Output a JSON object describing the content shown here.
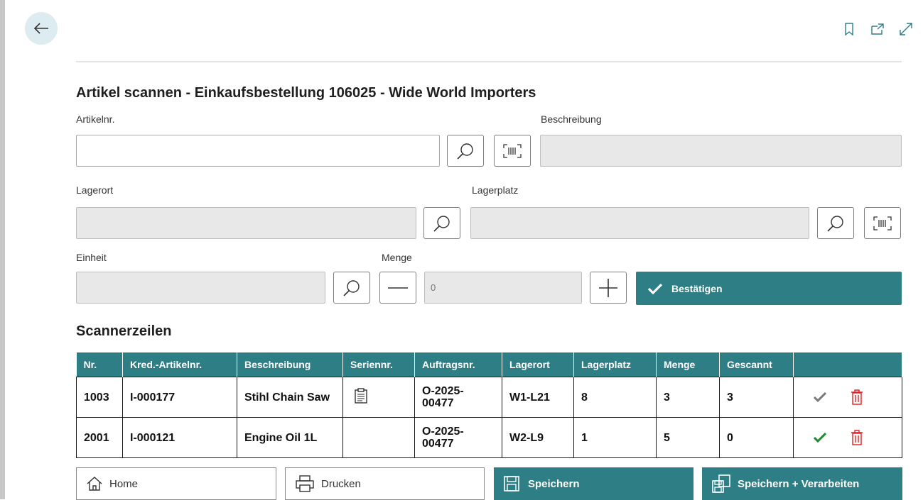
{
  "page": {
    "title": "Artikel scannen - Einkaufsbestellung 106025 - Wide World Importers"
  },
  "form": {
    "item_no_label": "Artikelnr.",
    "item_no_value": "",
    "description_label": "Beschreibung",
    "description_value": "",
    "location_label": "Lagerort",
    "location_value": "",
    "bin_label": "Lagerplatz",
    "bin_value": "",
    "unit_label": "Einheit",
    "unit_value": "",
    "quantity_label": "Menge",
    "quantity_placeholder": "0",
    "confirm_label": "Bestätigen"
  },
  "scanner_lines": {
    "title": "Scannerzeilen",
    "columns": [
      "Nr.",
      "Kred.-Artikelnr.",
      "Beschreibung",
      "Seriennr.",
      "Auftragsnr.",
      "Lagerort",
      "Lagerplatz",
      "Menge",
      "Gescannt",
      ""
    ],
    "rows": [
      {
        "nr": "1003",
        "vendor_item": "I-000177",
        "description": "Stihl Chain Saw",
        "serial": "",
        "order": "O-2025-00477",
        "location": "W1-L21",
        "bin": "8",
        "qty": "3",
        "scanned": "3",
        "status": "pending"
      },
      {
        "nr": "2001",
        "vendor_item": "I-000121",
        "description": "Engine Oil 1L",
        "serial": "",
        "order": "O-2025-00477",
        "location": "W2-L9",
        "bin": "1",
        "qty": "5",
        "scanned": "0",
        "status": "done"
      }
    ]
  },
  "footer": {
    "home_label": "Home",
    "print_label": "Drucken",
    "save_label": "Speichern",
    "save_process_label": "Speichern + Verarbeiten"
  },
  "colors": {
    "accent": "#2e7e86",
    "check_done": "#1e8a2e",
    "check_pending": "#7a7a7a",
    "delete": "#e02020"
  }
}
